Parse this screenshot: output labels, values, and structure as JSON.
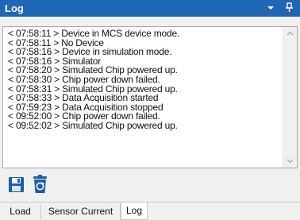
{
  "window": {
    "title": "Log",
    "dropdown_icon": "triangle-down-icon",
    "pin_icon": "pin-icon"
  },
  "log": {
    "lines": [
      "< 07:58:11 >  Device in MCS device mode.",
      "< 07:58:11 >  No Device",
      "< 07:58:16 >  Device in simulation mode.",
      "< 07:58:16 >  Simulator",
      "< 07:58:20 >  Simulated Chip powered up.",
      "< 07:58:30 >  Chip power down failed.",
      "< 07:58:31 >  Simulated Chip powered up.",
      "< 07:58:33 >  Data Acquisition started",
      "< 07:59:23 >  Data Acquisition stopped",
      "< 09:52:00 >  Chip power down failed.",
      "< 09:52:02 >  Simulated Chip powered up."
    ]
  },
  "toolbar": {
    "save_icon": "floppy-disk-icon",
    "clear_icon": "recycle-bin-icon"
  },
  "tabs": [
    {
      "label": "Load",
      "active": false
    },
    {
      "label": "Sensor Current",
      "active": false
    },
    {
      "label": "Log",
      "active": true
    }
  ],
  "colors": {
    "titlebar": "#1f66b5",
    "icon_blue": "#1a5fa8"
  }
}
